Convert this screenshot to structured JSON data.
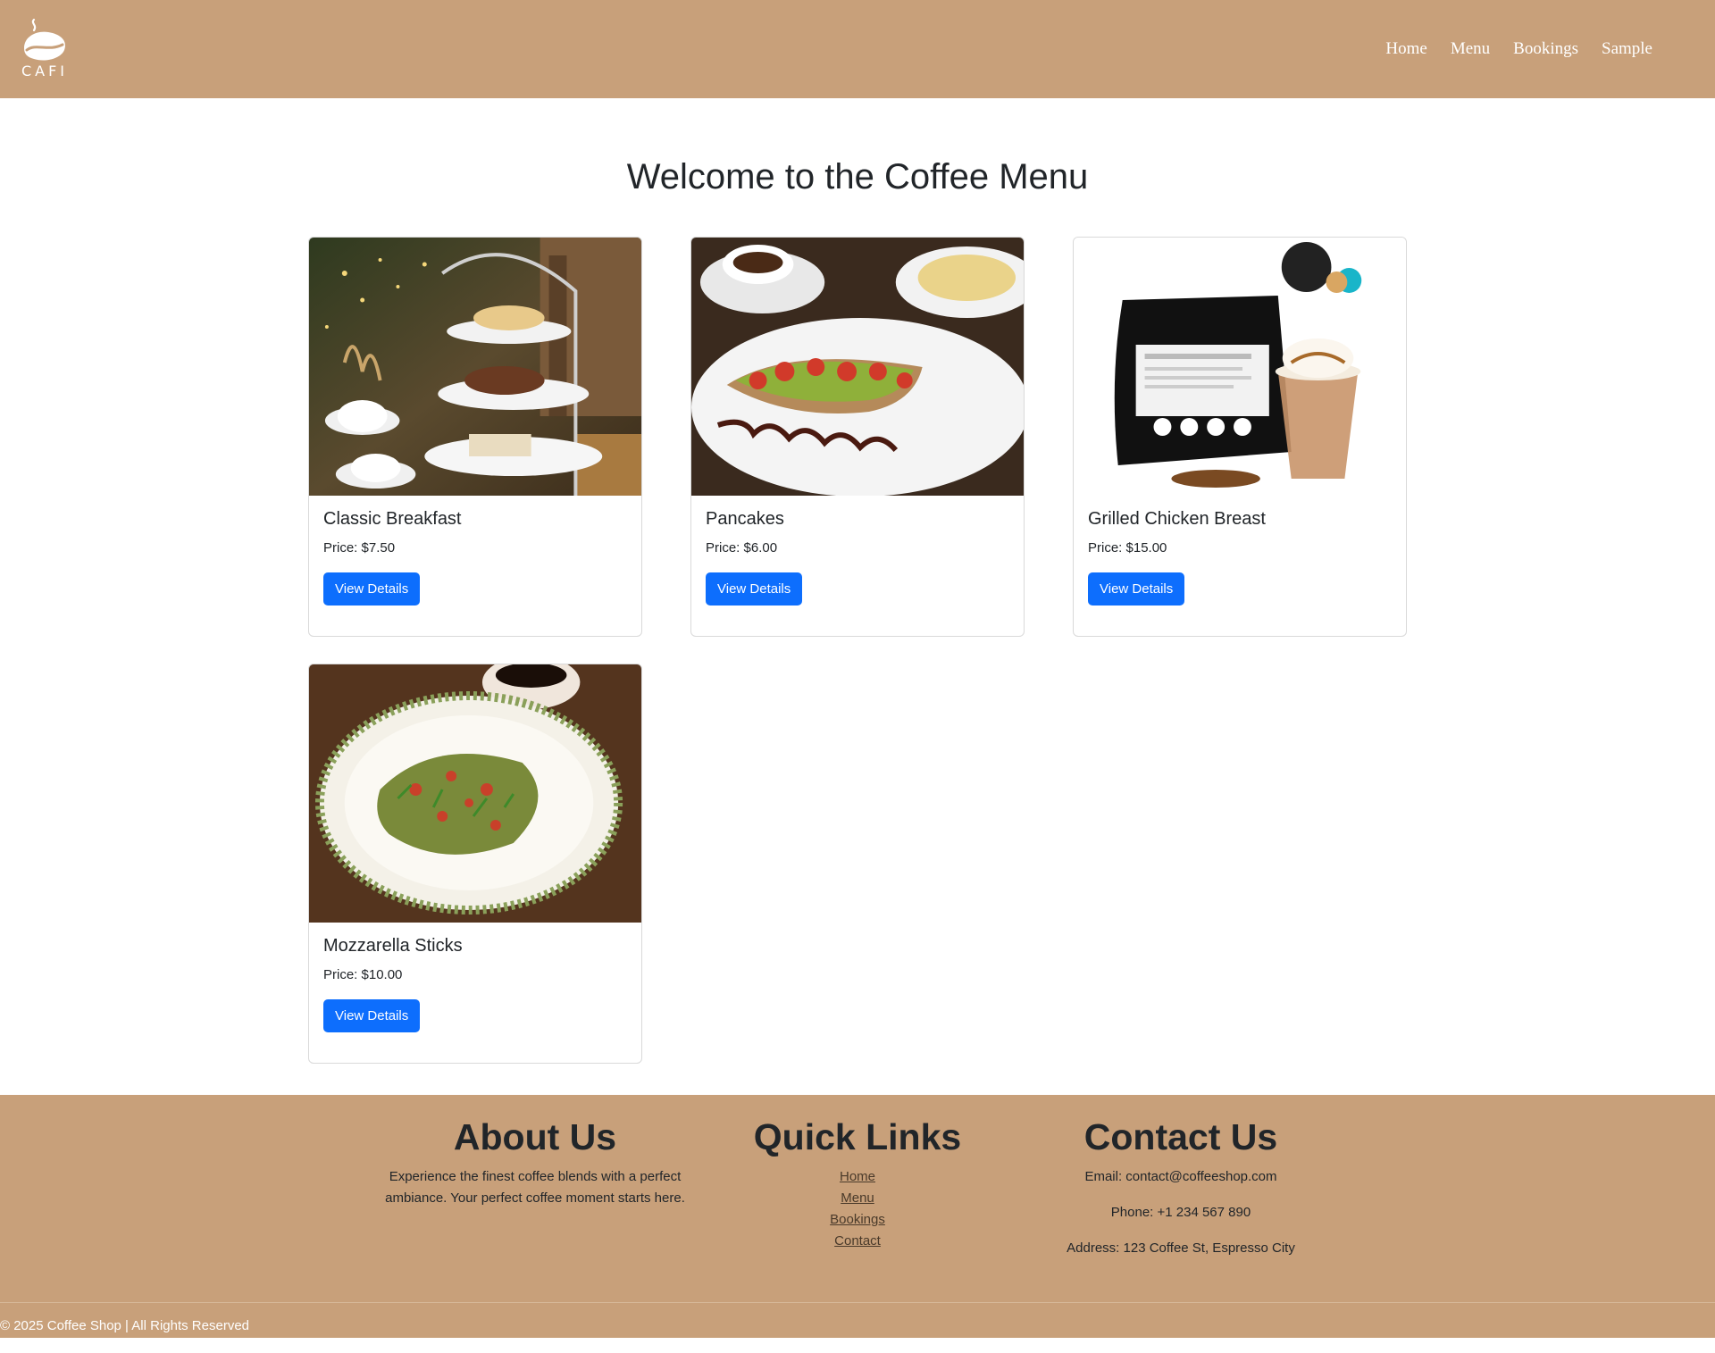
{
  "header": {
    "brand": "CAFI",
    "nav": [
      "Home",
      "Menu",
      "Bookings",
      "Sample"
    ]
  },
  "main": {
    "title": "Welcome to the Coffee Menu",
    "cards": [
      {
        "title": "Classic Breakfast",
        "price": "Price: $7.50",
        "button": "View Details"
      },
      {
        "title": "Pancakes",
        "price": "Price: $6.00",
        "button": "View Details"
      },
      {
        "title": "Grilled Chicken Breast",
        "price": "Price: $15.00",
        "button": "View Details"
      },
      {
        "title": "Mozzarella Sticks",
        "price": "Price: $10.00",
        "button": "View Details"
      }
    ]
  },
  "footer": {
    "about": {
      "heading": "About Us",
      "text": "Experience the finest coffee blends with a perfect ambiance. Your perfect coffee moment starts here."
    },
    "links": {
      "heading": "Quick Links",
      "items": [
        "Home",
        "Menu",
        "Bookings",
        "Contact"
      ]
    },
    "contact": {
      "heading": "Contact Us",
      "email": "Email: contact@coffeeshop.com",
      "phone": "Phone: +1 234 567 890",
      "address": "Address: 123 Coffee St, Espresso City"
    },
    "copyright": "© 2025 Coffee Shop | All Rights Reserved"
  },
  "colors": {
    "header_bg": "#c8a07a",
    "primary_button": "#0d6efd"
  }
}
